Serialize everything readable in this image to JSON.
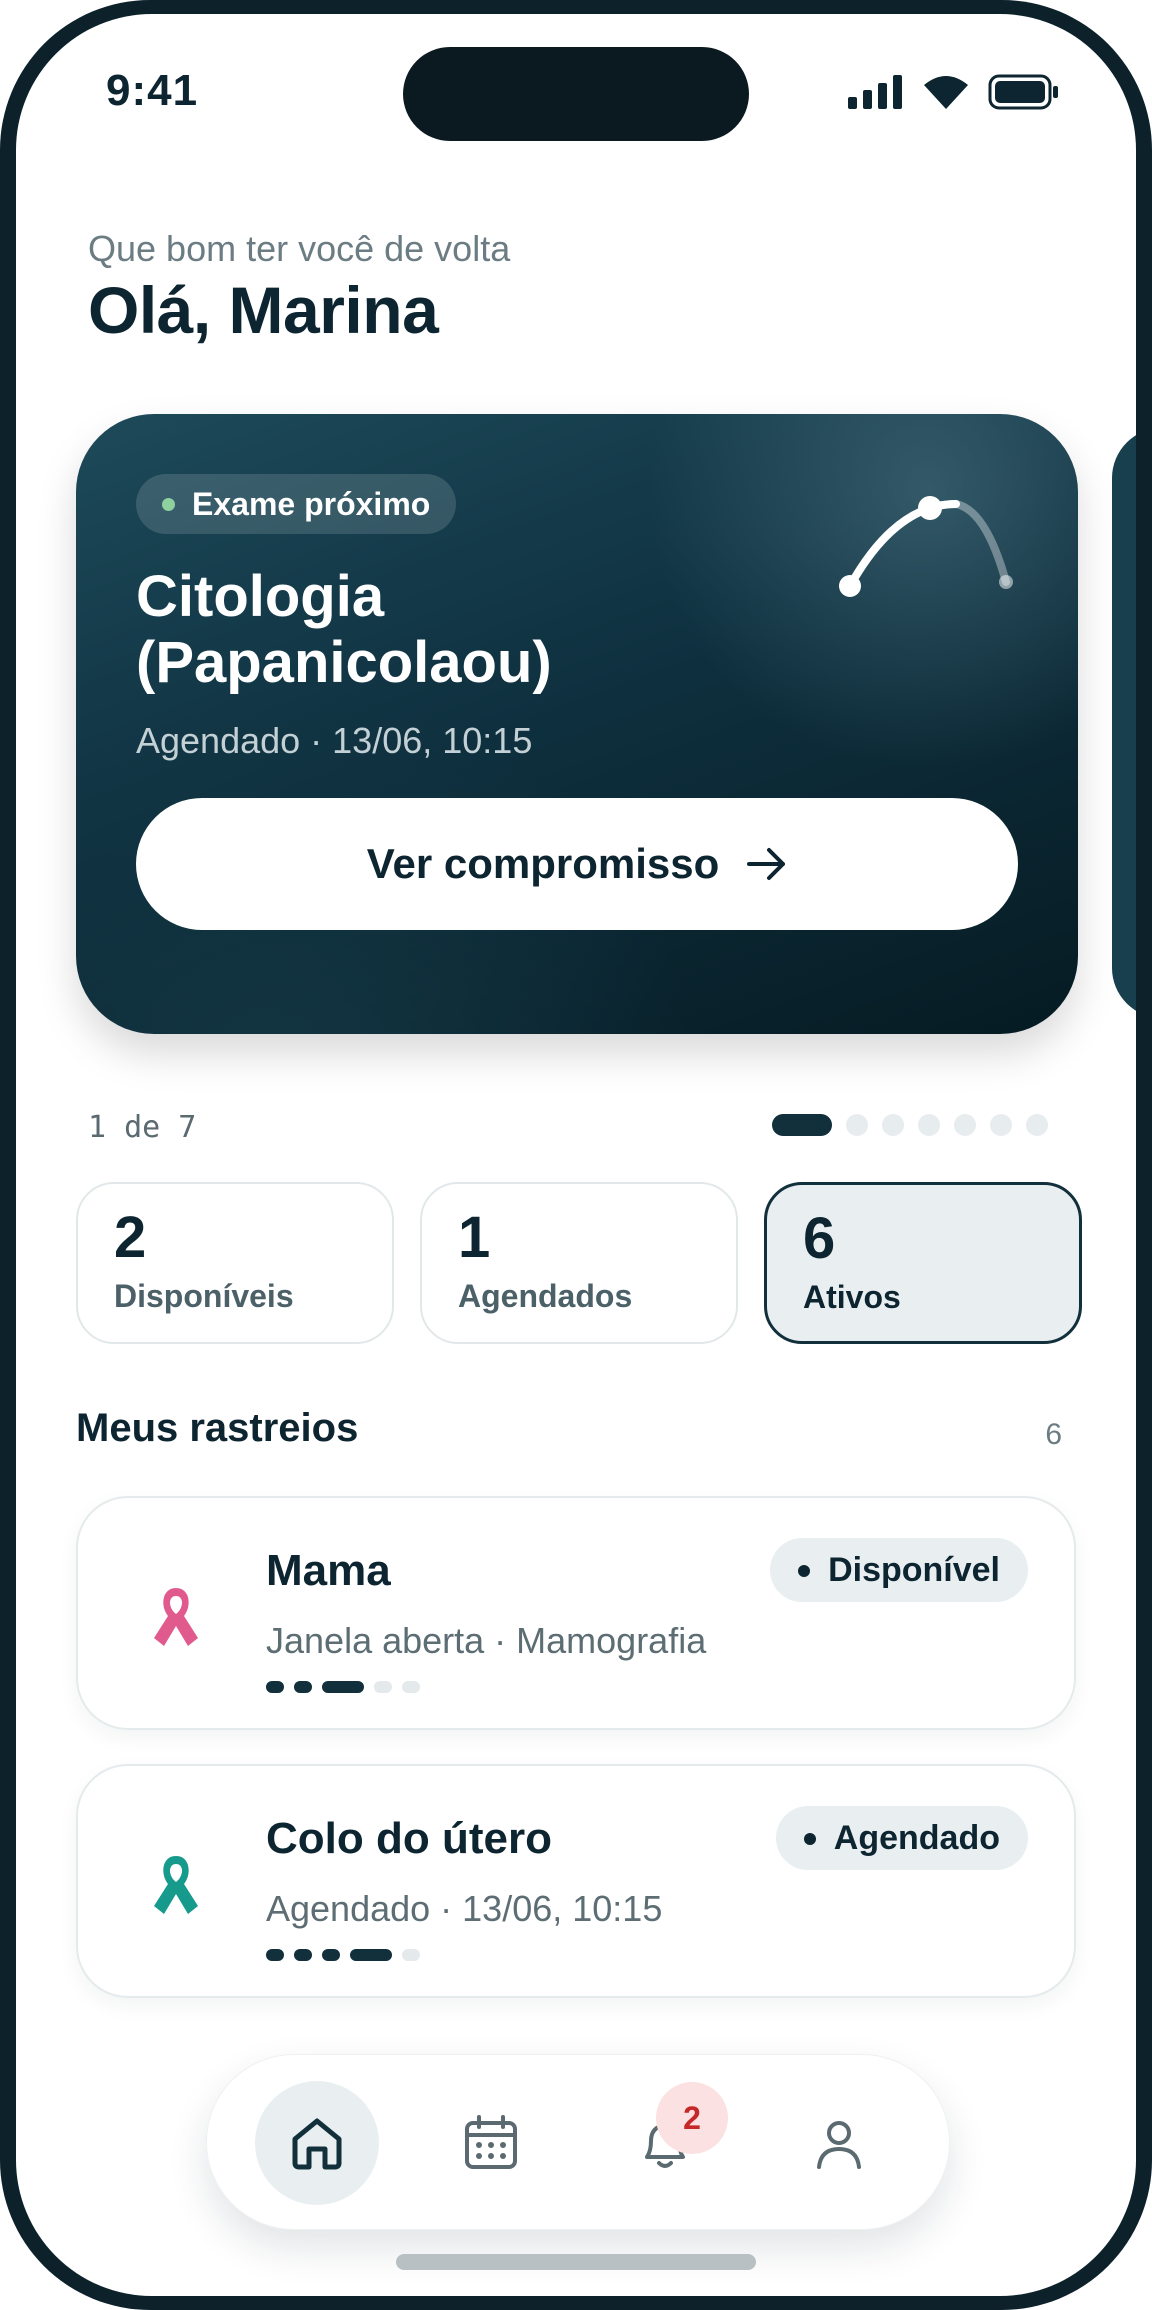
{
  "status_bar": {
    "time": "9:41"
  },
  "greeting": {
    "subtitle": "Que bom ter você de volta",
    "title": "Olá, Marina"
  },
  "hero": {
    "badge": "Exame próximo",
    "title": "Citologia (Papanicolaou)",
    "subtitle": "Agendado · 13/06, 10:15",
    "button_label": "Ver compromisso"
  },
  "pager": {
    "text": "1 de 7",
    "current": 1,
    "total": 7
  },
  "stats": [
    {
      "value": "2",
      "label": "Disponíveis"
    },
    {
      "value": "1",
      "label": "Agendados"
    },
    {
      "value": "6",
      "label": "Ativos"
    }
  ],
  "section": {
    "title": "Meus rastreios",
    "count": "6"
  },
  "screenings": [
    {
      "name": "Mama",
      "meta": "Janela aberta · Mamografia",
      "status": "Disponível",
      "ribbon_color": "#e05a8e"
    },
    {
      "name": "Colo do útero",
      "meta": "Agendado · 13/06, 10:15",
      "status": "Agendado",
      "ribbon_color": "#169a8c"
    }
  ],
  "nav": {
    "items": [
      "home-icon",
      "calendar-icon",
      "bell-icon",
      "user-icon"
    ],
    "notification_badge": "2"
  },
  "colors": {
    "primary": "#0d2530",
    "hero_dark": "#0f3140",
    "badge_bg": "#fbe1e1",
    "badge_text": "#c62828"
  }
}
